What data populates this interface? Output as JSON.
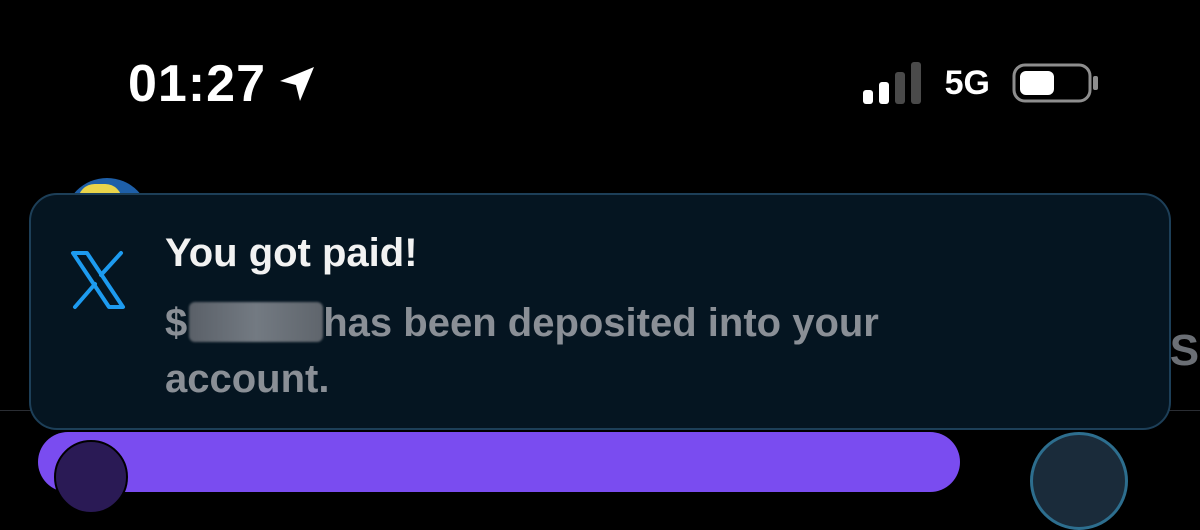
{
  "status_bar": {
    "time": "01:27",
    "network": "5G",
    "icons": [
      "location-arrow-icon",
      "cellular-signal-icon",
      "battery-icon"
    ]
  },
  "notification": {
    "app_icon": "x-logo-icon",
    "title": "You got paid!",
    "body_prefix": "$",
    "body_rest": "has been deposited into your account."
  },
  "background": {
    "side_peek_text": "So"
  },
  "colors": {
    "screen_bg": "#000000",
    "notification_bg": "#051521",
    "notification_border": "#1d3f58",
    "x_logo_blue": "#1d9bf0",
    "title_text": "#f2f2f2",
    "body_text": "#8a8f96",
    "accent_purple": "#7a4cf0"
  }
}
